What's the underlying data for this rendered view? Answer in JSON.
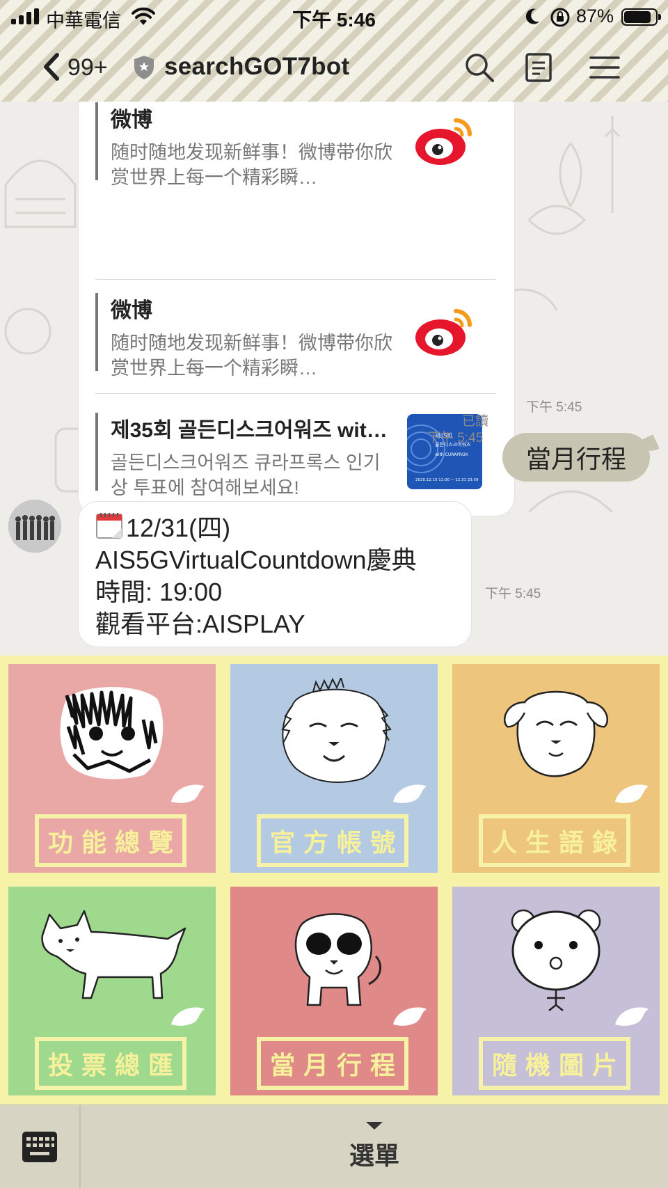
{
  "status_bar": {
    "carrier": "中華電信",
    "time": "下午 5:46",
    "battery_percent": "87%",
    "battery_level": 0.87
  },
  "nav": {
    "unread_count": "99+",
    "chat_title": "searchGOT7bot",
    "icons": [
      "back-icon",
      "shield-icon",
      "search-icon",
      "notes-icon",
      "menu-icon"
    ]
  },
  "chat": {
    "link_card": {
      "items": [
        {
          "title": "微博",
          "desc": "随时随地发现新鲜事！微博带你欣赏世界上每一个精彩瞬…",
          "thumb": "weibo-logo"
        },
        {
          "title": "微博",
          "desc": "随时随地发现新鲜事！微博带你欣赏世界上每一个精彩瞬…",
          "thumb": "weibo-logo"
        },
        {
          "title": "제35회 골든디스크어워즈 wit…",
          "desc": "골든디스크어워즈 큐라프록스 인기상 투표에 참여해보세요!",
          "thumb": "golden-disc-poster",
          "thumb_text": {
            "l1": "제35회",
            "l2": "골든디스크어워즈",
            "l3": "with CURAPROX",
            "dates": "2020.12.10 11:00 ~ 12.31 23:59"
          }
        }
      ],
      "time": "下午 5:45"
    },
    "sent": {
      "text": "當月行程",
      "read": "已讀",
      "time": "下午 5:45"
    },
    "received": {
      "lines": [
        "12/31(四)",
        "AIS5GVirtualCountdown慶典",
        "時間: 19:00",
        "觀看平台:AISPLAY"
      ],
      "time": "下午 5:45"
    }
  },
  "rich_menu": {
    "tiles": [
      {
        "label": "功能總覽",
        "color": "#e9a8a6",
        "art": "scribble-face"
      },
      {
        "label": "官方帳號",
        "color": "#b4c9e2",
        "art": "fluffy-dog"
      },
      {
        "label": "人生語錄",
        "color": "#eec57d",
        "art": "sleepy-dog"
      },
      {
        "label": "投票總匯",
        "color": "#9fd98e",
        "art": "walking-dog"
      },
      {
        "label": "當月行程",
        "color": "#df8a88",
        "art": "dog-with-sunglasses"
      },
      {
        "label": "隨機圖片",
        "color": "#c5bfd7",
        "art": "bear-doodle"
      }
    ]
  },
  "bottom_bar": {
    "menu_label": "選單",
    "keyboard_icon": "keyboard-icon"
  }
}
